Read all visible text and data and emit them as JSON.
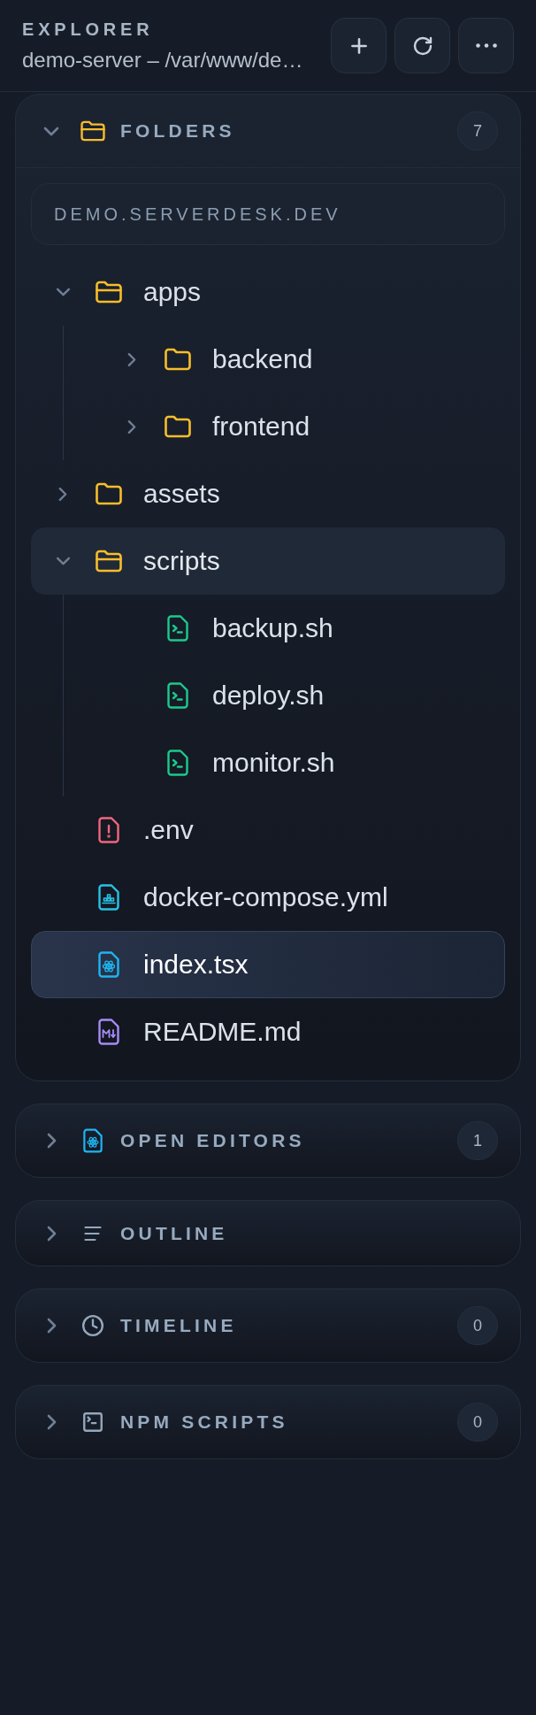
{
  "header": {
    "title": "EXPLORER",
    "subtitle": "demo-server – /var/www/de…"
  },
  "sections": [
    {
      "kind": "folders",
      "title": "FOLDERS",
      "expanded": true,
      "count": "7",
      "root": "DEMO.SERVERDESK.DEV",
      "tree": [
        {
          "kind": "folder",
          "name": "apps",
          "expanded": true,
          "selected": false,
          "hovered": false,
          "children": [
            {
              "kind": "folder",
              "name": "backend",
              "expanded": false,
              "selected": false,
              "hovered": false
            },
            {
              "kind": "folder",
              "name": "frontend",
              "expanded": false,
              "selected": false,
              "hovered": false
            }
          ]
        },
        {
          "kind": "folder",
          "name": "assets",
          "expanded": false,
          "selected": false,
          "hovered": false
        },
        {
          "kind": "folder",
          "name": "scripts",
          "expanded": true,
          "selected": false,
          "hovered": true,
          "children": [
            {
              "kind": "shell",
              "name": "backup.sh",
              "selected": false,
              "hovered": false
            },
            {
              "kind": "shell",
              "name": "deploy.sh",
              "selected": false,
              "hovered": false
            },
            {
              "kind": "shell",
              "name": "monitor.sh",
              "selected": false,
              "hovered": false
            }
          ]
        },
        {
          "kind": "env",
          "name": ".env",
          "selected": false,
          "hovered": false
        },
        {
          "kind": "yaml",
          "name": "docker-compose.yml",
          "selected": false,
          "hovered": false
        },
        {
          "kind": "react",
          "name": "index.tsx",
          "selected": true,
          "hovered": false
        },
        {
          "kind": "markdown",
          "name": "README.md",
          "selected": false,
          "hovered": false
        }
      ]
    },
    {
      "kind": "editors",
      "title": "OPEN EDITORS",
      "expanded": false,
      "count": "1"
    },
    {
      "kind": "outline",
      "title": "OUTLINE",
      "expanded": false
    },
    {
      "kind": "timeline",
      "title": "TIMELINE",
      "expanded": false,
      "count": "0"
    },
    {
      "kind": "npm",
      "title": "NPM SCRIPTS",
      "expanded": false,
      "count": "0"
    }
  ]
}
